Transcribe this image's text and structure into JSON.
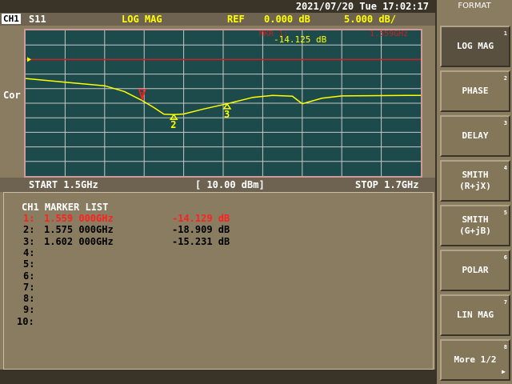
{
  "datetime": "2021/07/20 Tue 17:02:17",
  "channel": {
    "label": "CH1",
    "param": "S11",
    "format": "LOG MAG",
    "ref": "REF",
    "ref_value": "0.000 dB",
    "scale": "5.000 dB/"
  },
  "marker_readout": {
    "label": "MKR  1:",
    "freq": "1.559GHz",
    "value": "-14.125  dB"
  },
  "correction": "Cor",
  "footer": {
    "start": "START 1.5GHz",
    "power": "[ 10.00 dBm]",
    "stop": "STOP 1.7GHz"
  },
  "colors": {
    "trace": "#ffff00",
    "active_marker": "#ff2020",
    "ref_line": "#cc2020",
    "background": "#1d4a4a"
  },
  "chart_data": {
    "type": "line",
    "x_start_ghz": 1.5,
    "x_stop_ghz": 1.7,
    "ylim_db": [
      -40,
      10
    ],
    "ref_db": 0,
    "grid": true,
    "series": [
      {
        "x": [
          1.5,
          1.52,
          1.54,
          1.55,
          1.559,
          1.565,
          1.57,
          1.575,
          1.58,
          1.59,
          1.602,
          1.615,
          1.625,
          1.635,
          1.64,
          1.65,
          1.66,
          1.68,
          1.7
        ],
        "values": [
          -6.5,
          -7.8,
          -9.0,
          -11.0,
          -14.1,
          -16.5,
          -18.8,
          -18.9,
          -18.7,
          -17.0,
          -15.2,
          -13.0,
          -12.3,
          -12.6,
          -15.2,
          -13.3,
          -12.5,
          -12.4,
          -12.3
        ]
      }
    ],
    "markers": [
      {
        "id": "1",
        "freq": 1.559,
        "value": -14.129,
        "active": true
      },
      {
        "id": "2",
        "freq": 1.575,
        "value": -18.909,
        "active": false
      },
      {
        "id": "3",
        "freq": 1.602,
        "value": -15.231,
        "active": false
      }
    ]
  },
  "marker_list": {
    "title": "CH1 MARKER LIST",
    "rows": [
      {
        "num": "1:",
        "freq": "1.559 000GHz",
        "value": "-14.129 dB",
        "active": true
      },
      {
        "num": "2:",
        "freq": "1.575 000GHz",
        "value": "-18.909 dB",
        "active": false
      },
      {
        "num": "3:",
        "freq": "1.602 000GHz",
        "value": "-15.231 dB",
        "active": false
      },
      {
        "num": "4:",
        "freq": "",
        "value": "",
        "active": false
      },
      {
        "num": "5:",
        "freq": "",
        "value": "",
        "active": false
      },
      {
        "num": "6:",
        "freq": "",
        "value": "",
        "active": false
      },
      {
        "num": "7:",
        "freq": "",
        "value": "",
        "active": false
      },
      {
        "num": "8:",
        "freq": "",
        "value": "",
        "active": false
      },
      {
        "num": "9:",
        "freq": "",
        "value": "",
        "active": false
      },
      {
        "num": "10:",
        "freq": "",
        "value": "",
        "active": false
      }
    ]
  },
  "menu": {
    "title": "FORMAT",
    "items": [
      {
        "label": "LOG MAG",
        "num": "1",
        "active": true
      },
      {
        "label": "PHASE",
        "num": "2"
      },
      {
        "label": "DELAY",
        "num": "3"
      },
      {
        "label": "SMITH",
        "label2": "(R+jX)",
        "num": "4"
      },
      {
        "label": "SMITH",
        "label2": "(G+jB)",
        "num": "5"
      },
      {
        "label": "POLAR",
        "num": "6"
      },
      {
        "label": "LIN MAG",
        "num": "7"
      },
      {
        "label": "More 1/2",
        "num": "8",
        "arrow": "▶"
      }
    ]
  }
}
